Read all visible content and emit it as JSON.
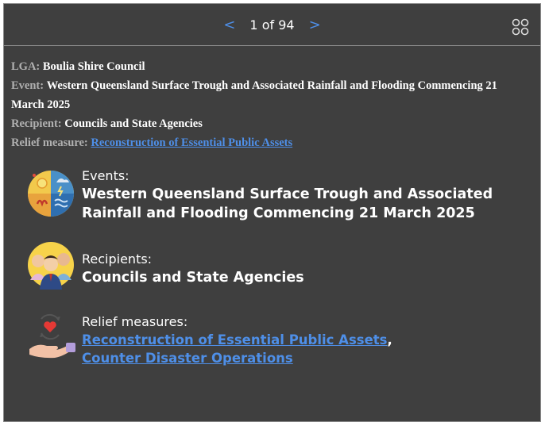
{
  "pager": {
    "prev_label": "<",
    "current": "1 of 94",
    "next_label": ">"
  },
  "attributes": {
    "lga_label": "LGA:",
    "lga_value": "Boulia Shire Council",
    "event_label": "Event:",
    "event_value": "Western Queensland Surface Trough and Associated Rainfall and Flooding Commencing 21 March 2025",
    "recipient_label": "Recipient:",
    "recipient_value": "Councils and State Agencies",
    "relief_label": "Relief measure:",
    "relief_value": "Reconstruction of Essential Public Assets"
  },
  "cards": {
    "events": {
      "caption": "Events:",
      "value": "Western Queensland Surface Trough and Associated Rainfall and Flooding Commencing 21 March 2025"
    },
    "recipients": {
      "caption": "Recipients:",
      "value": "Councils and State Agencies"
    },
    "relief": {
      "caption": "Relief measures:",
      "link1": "Reconstruction of Essential Public Assets",
      "separator": ",",
      "link2": "Counter Disaster Operations"
    }
  },
  "colors": {
    "panel_bg": "#3f3f3f",
    "link": "#4e8fe8",
    "label_grey": "#b0b0b0",
    "text": "#ffffff"
  },
  "icons": [
    "grid-view-icon",
    "disaster-events-icon",
    "recipients-people-icon",
    "relief-hand-heart-icon"
  ]
}
